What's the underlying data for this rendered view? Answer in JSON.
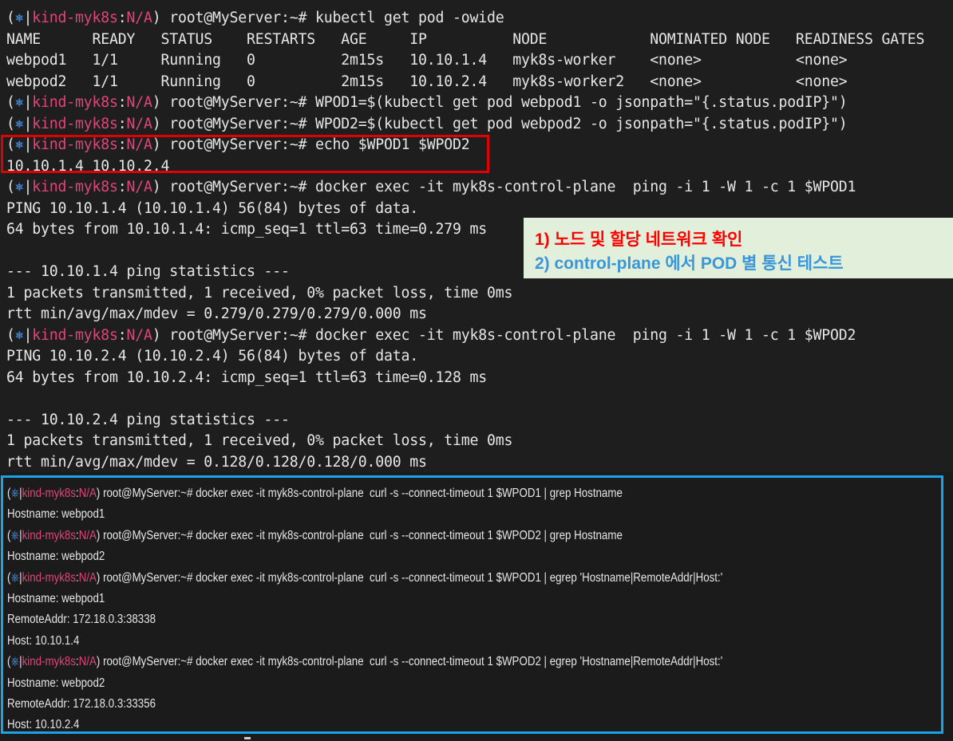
{
  "prompt": {
    "icon": "⎈",
    "context": "kind-myk8s",
    "namespace": "N/A",
    "user_host": "root@MyServer:~#"
  },
  "top_lines": [
    {
      "type": "cmd",
      "text": "kubectl get pod -owide"
    },
    {
      "type": "out",
      "text": "NAME      READY   STATUS    RESTARTS   AGE     IP          NODE            NOMINATED NODE   READINESS GATES"
    },
    {
      "type": "out",
      "text": "webpod1   1/1     Running   0          2m15s   10.10.1.4   myk8s-worker    <none>           <none>"
    },
    {
      "type": "out",
      "text": "webpod2   1/1     Running   0          2m15s   10.10.2.4   myk8s-worker2   <none>           <none>"
    },
    {
      "type": "cmd",
      "text": "WPOD1=$(kubectl get pod webpod1 -o jsonpath=\"{.status.podIP}\")"
    },
    {
      "type": "cmd",
      "text": "WPOD2=$(kubectl get pod webpod2 -o jsonpath=\"{.status.podIP}\")"
    },
    {
      "type": "cmd",
      "text": "echo $WPOD1 $WPOD2"
    },
    {
      "type": "out",
      "text": "10.10.1.4 10.10.2.4"
    },
    {
      "type": "cmd",
      "text": "docker exec -it myk8s-control-plane  ping -i 1 -W 1 -c 1 $WPOD1"
    },
    {
      "type": "out",
      "text": "PING 10.10.1.4 (10.10.1.4) 56(84) bytes of data."
    },
    {
      "type": "out",
      "text": "64 bytes from 10.10.1.4: icmp_seq=1 ttl=63 time=0.279 ms"
    },
    {
      "type": "out",
      "text": ""
    },
    {
      "type": "out",
      "text": "--- 10.10.1.4 ping statistics ---"
    },
    {
      "type": "out",
      "text": "1 packets transmitted, 1 received, 0% packet loss, time 0ms"
    },
    {
      "type": "out",
      "text": "rtt min/avg/max/mdev = 0.279/0.279/0.279/0.000 ms"
    },
    {
      "type": "cmd",
      "text": "docker exec -it myk8s-control-plane  ping -i 1 -W 1 -c 1 $WPOD2"
    },
    {
      "type": "out",
      "text": "PING 10.10.2.4 (10.10.2.4) 56(84) bytes of data."
    },
    {
      "type": "out",
      "text": "64 bytes from 10.10.2.4: icmp_seq=1 ttl=63 time=0.128 ms"
    },
    {
      "type": "out",
      "text": ""
    },
    {
      "type": "out",
      "text": "--- 10.10.2.4 ping statistics ---"
    },
    {
      "type": "out",
      "text": "1 packets transmitted, 1 received, 0% packet loss, time 0ms"
    },
    {
      "type": "out",
      "text": "rtt min/avg/max/mdev = 0.128/0.128/0.128/0.000 ms"
    }
  ],
  "bottom_lines": [
    {
      "type": "cmd",
      "text": "docker exec -it myk8s-control-plane  curl -s --connect-timeout 1 $WPOD1 | grep Hostname"
    },
    {
      "type": "out",
      "text": "Hostname: webpod1"
    },
    {
      "type": "cmd",
      "text": "docker exec -it myk8s-control-plane  curl -s --connect-timeout 1 $WPOD2 | grep Hostname"
    },
    {
      "type": "out",
      "text": "Hostname: webpod2"
    },
    {
      "type": "cmd",
      "text": "docker exec -it myk8s-control-plane  curl -s --connect-timeout 1 $WPOD1 | egrep 'Hostname|RemoteAddr|Host:'"
    },
    {
      "type": "out",
      "text": "Hostname: webpod1"
    },
    {
      "type": "out",
      "text": "RemoteAddr: 172.18.0.3:38338"
    },
    {
      "type": "out",
      "text": "Host: 10.10.1.4"
    },
    {
      "type": "cmd",
      "text": "docker exec -it myk8s-control-plane  curl -s --connect-timeout 1 $WPOD2 | egrep 'Hostname|RemoteAddr|Host:'"
    },
    {
      "type": "out",
      "text": "Hostname: webpod2"
    },
    {
      "type": "out",
      "text": "RemoteAddr: 172.18.0.3:33356"
    },
    {
      "type": "out",
      "text": "Host: 10.10.2.4"
    }
  ],
  "annotation": {
    "line1": "1) 노드 및 할당 네트워크 확인",
    "line2": "2) control-plane 에서 POD 별 통신 테스트"
  },
  "colors": {
    "background": "#1e1e1e",
    "text": "#e6e6e6",
    "k8s_icon": "#4a8fe0",
    "context": "#e0457a",
    "red_box": "#e00000",
    "blue_box": "#1aa3e8",
    "note_bg": "#e2efda",
    "note_red": "#ff0000",
    "note_blue": "#3a96d8"
  }
}
